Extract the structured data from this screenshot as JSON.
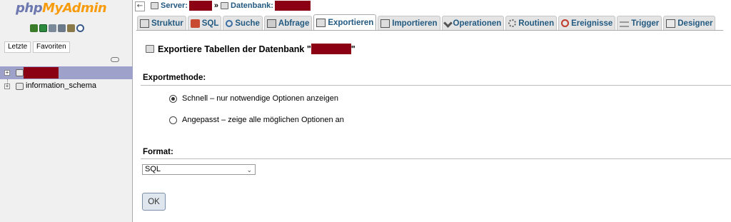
{
  "nav": {
    "logo_php": "php",
    "logo_admin": "MyAdmin",
    "icons": [
      "home-icon",
      "logout-icon",
      "docs-icon",
      "help-icon",
      "settings-icon",
      "reload-icon"
    ],
    "recent_label": "Letzte",
    "favorites_label": "Favoriten",
    "tree": [
      {
        "label": "",
        "redacted": true,
        "selected": true
      },
      {
        "label": "information_schema",
        "redacted": false,
        "selected": false
      }
    ]
  },
  "breadcrumb": {
    "server_label": "Server:",
    "separator": "»",
    "database_label": "Datenbank:"
  },
  "tabs": [
    {
      "label": "Struktur",
      "icon": "structure-icon",
      "active": false
    },
    {
      "label": "SQL",
      "icon": "sql-icon",
      "active": false
    },
    {
      "label": "Suche",
      "icon": "search-icon",
      "active": false
    },
    {
      "label": "Abfrage",
      "icon": "query-icon",
      "active": false
    },
    {
      "label": "Exportieren",
      "icon": "export-icon",
      "active": true
    },
    {
      "label": "Importieren",
      "icon": "import-icon",
      "active": false
    },
    {
      "label": "Operationen",
      "icon": "operations-icon",
      "active": false
    },
    {
      "label": "Routinen",
      "icon": "routines-icon",
      "active": false
    },
    {
      "label": "Ereignisse",
      "icon": "events-icon",
      "active": false
    },
    {
      "label": "Trigger",
      "icon": "trigger-icon",
      "active": false
    },
    {
      "label": "Designer",
      "icon": "designer-icon",
      "active": false
    }
  ],
  "main": {
    "title_prefix": "Exportiere Tabellen der Datenbank \"",
    "title_suffix": "\"",
    "export_method_heading": "Exportmethode:",
    "method_quick": "Schnell – nur notwendige Optionen anzeigen",
    "method_custom": "Angepasst – zeige alle möglichen Optionen an",
    "selected_method": "quick",
    "format_heading": "Format:",
    "format_value": "SQL",
    "ok_label": "OK"
  },
  "colors": {
    "link_blue": "#235a81",
    "redaction": "#8b0013",
    "selected_db_bg": "#9ea1c9",
    "logo_php": "#6c78af",
    "logo_admin": "#f89c0e"
  }
}
